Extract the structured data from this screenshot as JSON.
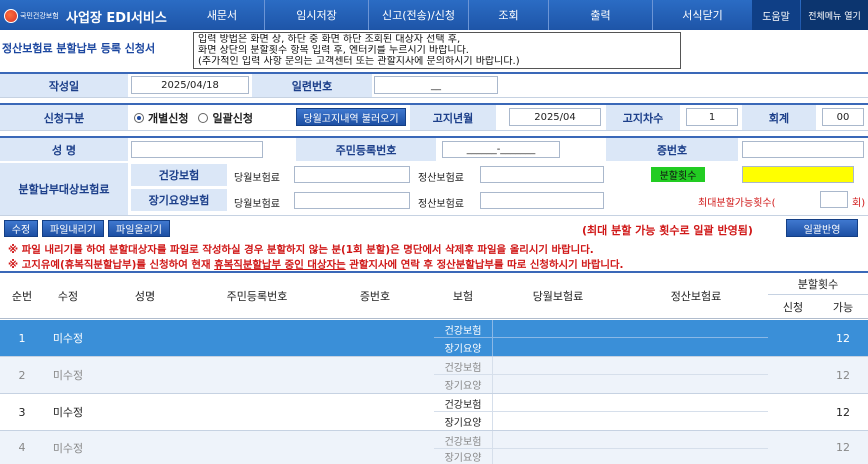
{
  "header": {
    "logo_text": "국민건강보험",
    "app_title": "사업장 EDI서비스",
    "menu": [
      "새문서",
      "임시저장",
      "신고(전송)/신청",
      "조회",
      "출력",
      "서식닫기"
    ],
    "help": "도움말",
    "all_menu": "전체메뉴 열기"
  },
  "page": {
    "title": "정산보험료 분할납부 등록 신청서",
    "notice": [
      "입력 방법은 화면 상, 하단 중 화면 하단 조회된 대상자 선택 후,",
      "화면 상단의 분할횟수 항목 입력 후, 엔터키를 누르시기 바랍니다.",
      "(추가적인 입력 사항 문의는 고객센터 또는 관할지사에 문의하시기 바랍니다.)"
    ]
  },
  "form": {
    "written_date_label": "작성일",
    "written_date": "2025/04/18",
    "serial_label": "일련번호",
    "serial_value": "__",
    "apply_type_label": "신청구분",
    "apply_individual": "개별신청",
    "apply_bulk": "일괄신청",
    "fetch_button": "당월고지내역 불러오기",
    "notice_ym_label": "고지년월",
    "notice_ym": "2025/04",
    "notice_seq_label": "고지차수",
    "notice_seq": "1",
    "session_label": "회계",
    "session_value": "00",
    "name_label": "성 명",
    "rrn_label": "주민등록번호",
    "rrn_value": "______-_______",
    "cert_label": "증번호",
    "target_label": "분할납부대상보험료",
    "health_label": "건강보험",
    "ltc_label": "장기요양보험",
    "current_premium": "당월보험료",
    "settlement_premium": "정산보험료",
    "installments_label": "분할횟수",
    "max_label": "최대분할가능횟수(",
    "max_unit": "회)"
  },
  "actions": {
    "edit": "수정",
    "download": "파일내리기",
    "upload": "파일올리기",
    "max_note": "(최대 분할 가능 횟수로 일괄 반영됨)",
    "bulk_apply": "일괄반영",
    "warning1": "※ 파일 내리기를 하여 분할대상자를 파일로 작성하실 경우 분할하지 않는 분(1회 분할)은 명단에서 삭제후 파일을 올리시기 바랍니다.",
    "warning2_a": "※ 고지유예(휴복직분할납부)를 신청하여 현재 ",
    "warning2_u": "휴복직분할납부 중인 대상자는",
    "warning2_b": " 관할지사에 연락 후 정산분할납부를 따로 신청하시기 바랍니다."
  },
  "table": {
    "headers": {
      "no": "순번",
      "edit": "수정",
      "name": "성명",
      "rrn": "주민등록번호",
      "cert": "증번호",
      "insurance": "보험",
      "current": "당월보험료",
      "settlement": "정산보험료",
      "installments": "분할횟수",
      "apply": "신청",
      "possible": "가능"
    },
    "rows": [
      {
        "no": "1",
        "edit": "미수정",
        "health": "건강보험",
        "ltc": "장기요양",
        "possible": "12"
      },
      {
        "no": "2",
        "edit": "미수정",
        "health": "건강보험",
        "ltc": "장기요양",
        "possible": "12"
      },
      {
        "no": "3",
        "edit": "미수정",
        "health": "건강보험",
        "ltc": "장기요양",
        "possible": "12"
      },
      {
        "no": "4",
        "edit": "미수정",
        "health": "건강보험",
        "ltc": "장기요양",
        "possible": "12"
      }
    ],
    "selected_color": "#3a8fd8"
  },
  "colors": {
    "nav": "#1e55a8",
    "label_bg": "#dbe7f7",
    "highlight_yellow": "#ffff00",
    "highlight_green": "#22cc22",
    "warning": "#d01818"
  }
}
